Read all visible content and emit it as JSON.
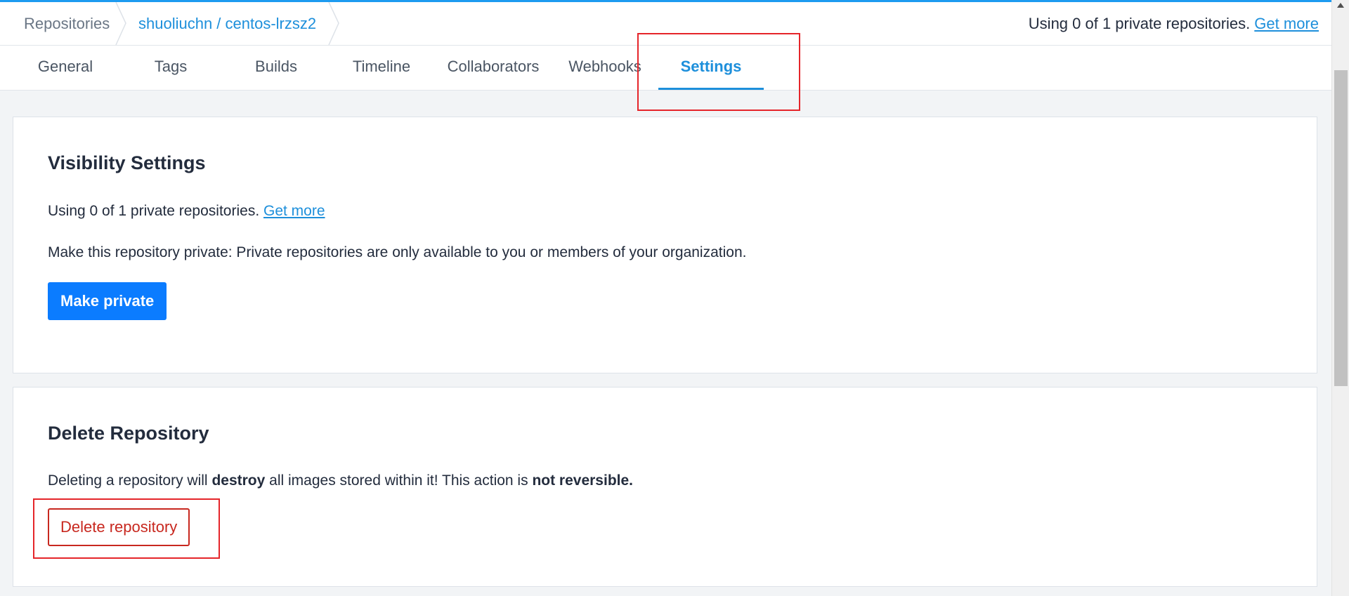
{
  "breadcrumb": {
    "repositories_label": "Repositories",
    "current_repo": "shuoliuchn / centos-lrzsz2"
  },
  "plan_usage": {
    "text": "Using 0 of 1 private repositories.",
    "link": "Get more"
  },
  "tabs": [
    {
      "label": "General",
      "active": false
    },
    {
      "label": "Tags",
      "active": false
    },
    {
      "label": "Builds",
      "active": false
    },
    {
      "label": "Timeline",
      "active": false
    },
    {
      "label": "Collaborators",
      "active": false
    },
    {
      "label": "Webhooks",
      "active": false
    },
    {
      "label": "Settings",
      "active": true
    }
  ],
  "visibility": {
    "title": "Visibility Settings",
    "usage_text": "Using 0 of 1 private repositories.",
    "usage_link": "Get more",
    "description": "Make this repository private: Private repositories are only available to you or members of your organization.",
    "button_label": "Make private"
  },
  "delete": {
    "title": "Delete Repository",
    "text_part1": "Deleting a repository will",
    "text_bold1": "destroy",
    "text_part2": "all images stored within it! This action is",
    "text_bold2": "not reversible.",
    "button_label": "Delete repository"
  },
  "colors": {
    "accent": "#1d8fdb",
    "primary_button": "#0b7cff",
    "danger": "#c8281f",
    "highlight_box": "#e5252a"
  }
}
